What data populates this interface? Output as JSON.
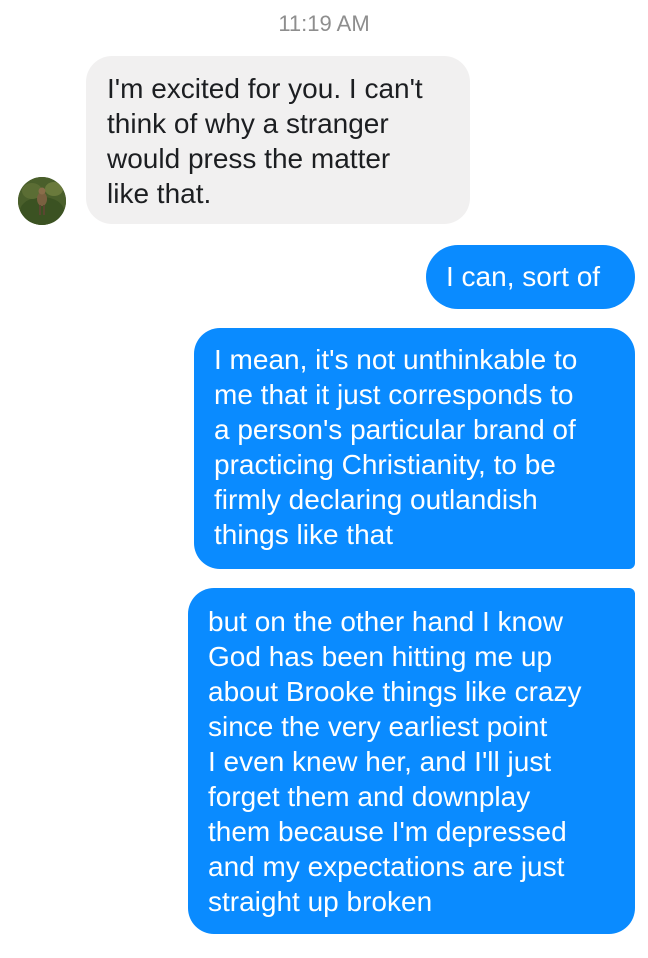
{
  "timestamp": "11:19 AM",
  "messages": [
    {
      "direction": "incoming",
      "text": "I'm excited for you. I can't\nthink of why a stranger\nwould press the matter\nlike that."
    },
    {
      "direction": "outgoing",
      "text": "I can, sort of"
    },
    {
      "direction": "outgoing",
      "text": "I mean, it's not unthinkable to\nme that it just corresponds to\na person's particular brand of\npracticing Christianity, to be\nfirmly declaring outlandish\nthings like that"
    },
    {
      "direction": "outgoing",
      "text": "but on the other hand I know\nGod has been hitting me up\nabout Brooke things like crazy\nsince the very earliest point\nI even knew her, and I'll just\nforget them and downplay\nthem because I'm depressed\nand my expectations are just\nstraight up broken"
    }
  ],
  "colors": {
    "outgoing_bubble": "#0a8bff",
    "incoming_bubble": "#f1f0f0",
    "timestamp_text": "#8e8e8e"
  },
  "icons": {
    "sender_avatar": "avatar-photo"
  }
}
